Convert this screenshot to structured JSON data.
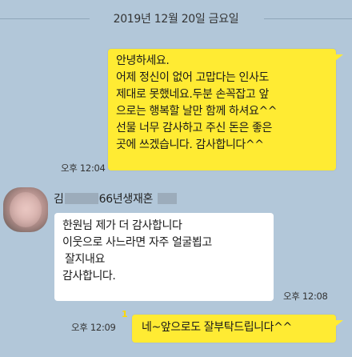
{
  "date_separator": "2019년 12월 20일 금요일",
  "messages": [
    {
      "side": "me",
      "lines": [
        "안녕하세요.",
        "어제 정신이 없어 고맙다는 인사도",
        "제대로 못했네요.두분 손꼭잡고 앞",
        "으로는 행복할 날만 함께 하셔요^^",
        "선물 너무 감사하고 주신 돈은 좋은",
        "곳에 쓰겠습니다. 감사합니다^^"
      ],
      "time": "오후 12:04"
    },
    {
      "side": "other",
      "sender_prefix": "김",
      "sender_suffix": "66년생재혼",
      "lines": [
        "한원님 제가 더 감사합니다",
        "이웃으로 사느라면 자주 얼굴뵙고",
        "잘지내요",
        "감사합니다."
      ],
      "time": "오후 12:08"
    },
    {
      "side": "me",
      "unread": "1",
      "lines": [
        "네~앞으로도 잘부탁드립니다^^"
      ],
      "time": "오후 12:09"
    }
  ],
  "colors": {
    "background": "#b2c7d9",
    "my_bubble": "#ffeb33",
    "other_bubble": "#ffffff",
    "unread_count": "#ffd900"
  }
}
